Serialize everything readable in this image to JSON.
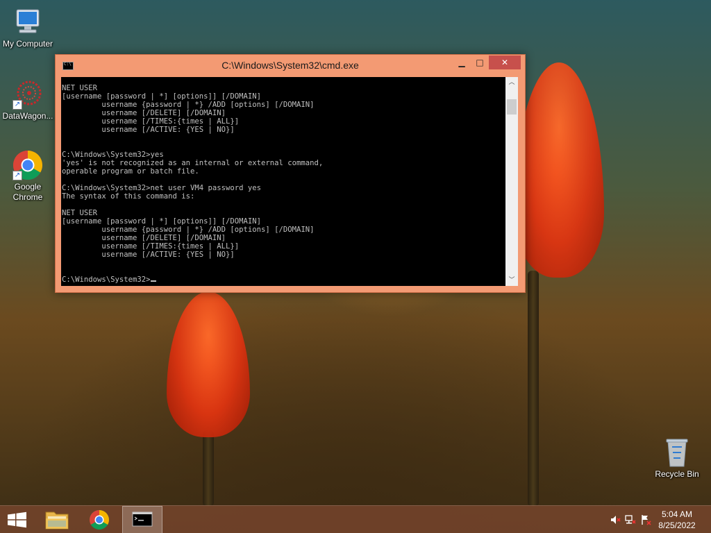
{
  "desktop": {
    "icons": [
      {
        "label": "My Computer"
      },
      {
        "label": "DataWagon..."
      },
      {
        "label": "Google Chrome"
      },
      {
        "label": "Recycle Bin"
      }
    ]
  },
  "cmd_window": {
    "title": "C:\\Windows\\System32\\cmd.exe",
    "lines": [
      "NET USER",
      "[username [password | *] [options]] [/DOMAIN]",
      "         username {password | *} /ADD [options] [/DOMAIN]",
      "         username [/DELETE] [/DOMAIN]",
      "         username [/TIMES:{times | ALL}]",
      "         username [/ACTIVE: {YES | NO}]",
      "",
      "",
      "C:\\Windows\\System32>yes",
      "'yes' is not recognized as an internal or external command,",
      "operable program or batch file.",
      "",
      "C:\\Windows\\System32>net user VM4 password yes",
      "The syntax of this command is:",
      "",
      "NET USER",
      "[username [password | *] [options]] [/DOMAIN]",
      "         username {password | *} /ADD [options] [/DOMAIN]",
      "         username [/DELETE] [/DOMAIN]",
      "         username [/TIMES:{times | ALL}]",
      "         username [/ACTIVE: {YES | NO}]",
      "",
      "",
      "C:\\Windows\\System32>"
    ],
    "colors": {
      "frame": "#f39a73",
      "close": "#c7504c",
      "console_bg": "#000000",
      "console_fg": "#c0c0c0"
    }
  },
  "taskbar": {
    "clock": {
      "time": "5:04 AM",
      "date": "8/25/2022"
    },
    "pinned": [
      "start-icon",
      "file-explorer-icon",
      "chrome-icon",
      "cmd-icon"
    ],
    "tray_icons": [
      "volume-muted-icon",
      "network-icon",
      "action-center-flag-icon"
    ],
    "color": "#78462d"
  }
}
